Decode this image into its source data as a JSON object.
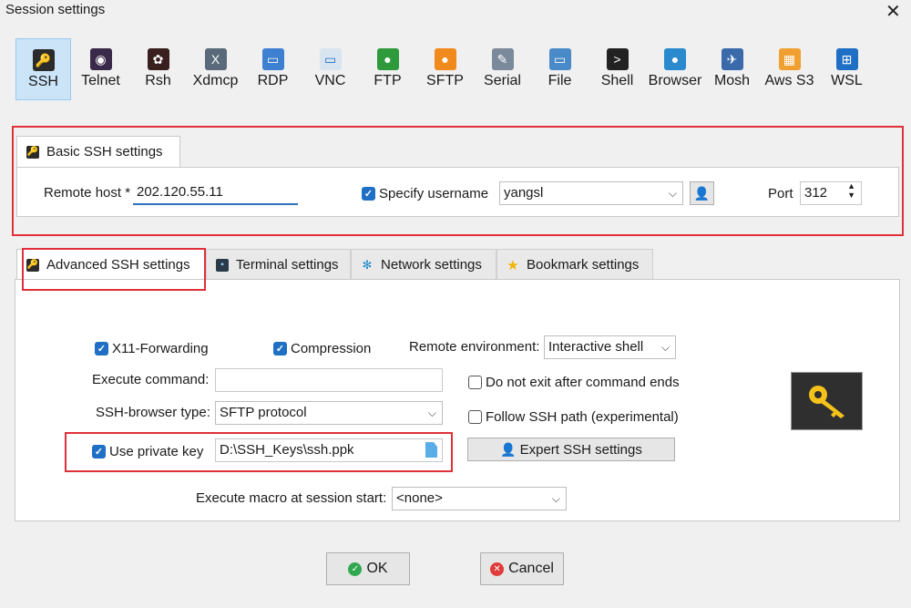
{
  "window": {
    "title": "Session settings"
  },
  "session_types": [
    {
      "label": "SSH",
      "icon": "ssh-key-icon",
      "color": "#2b2b2b"
    },
    {
      "label": "Telnet",
      "icon": "telnet-icon",
      "color": "#3a2a4a"
    },
    {
      "label": "Rsh",
      "icon": "rsh-icon",
      "color": "#3a1f1f"
    },
    {
      "label": "Xdmcp",
      "icon": "xdmcp-icon",
      "color": "#5a6a7a"
    },
    {
      "label": "RDP",
      "icon": "rdp-monitor-icon",
      "color": "#3d7fd1"
    },
    {
      "label": "VNC",
      "icon": "vnc-icon",
      "color": "#d8e4f0"
    },
    {
      "label": "FTP",
      "icon": "ftp-globe-icon",
      "color": "#2e9a3c"
    },
    {
      "label": "SFTP",
      "icon": "sftp-icon",
      "color": "#f08a1c"
    },
    {
      "label": "Serial",
      "icon": "serial-plug-icon",
      "color": "#7a8a9a"
    },
    {
      "label": "File",
      "icon": "file-monitor-icon",
      "color": "#4a8ac8"
    },
    {
      "label": "Shell",
      "icon": "shell-terminal-icon",
      "color": "#222222"
    },
    {
      "label": "Browser",
      "icon": "browser-globe-icon",
      "color": "#2a8acd"
    },
    {
      "label": "Mosh",
      "icon": "mosh-satellite-icon",
      "color": "#3a6aaa"
    },
    {
      "label": "Aws S3",
      "icon": "aws-s3-icon",
      "color": "#f0a030"
    },
    {
      "label": "WSL",
      "icon": "wsl-windows-icon",
      "color": "#1f6fc4"
    }
  ],
  "basic": {
    "tab_label": "Basic SSH settings",
    "remote_host_label": "Remote host *",
    "remote_host_value": "202.120.55.11",
    "specify_username_label": "Specify username",
    "specify_username_checked": true,
    "username_value": "yangsl",
    "port_label": "Port",
    "port_value": "312"
  },
  "tabs": [
    {
      "label": "Advanced SSH settings",
      "icon": "key-icon"
    },
    {
      "label": "Terminal settings",
      "icon": "terminal-icon"
    },
    {
      "label": "Network settings",
      "icon": "network-icon"
    },
    {
      "label": "Bookmark settings",
      "icon": "star-icon"
    }
  ],
  "advanced": {
    "x11_label": "X11-Forwarding",
    "x11_checked": true,
    "compression_label": "Compression",
    "compression_checked": true,
    "remote_env_label": "Remote environment:",
    "remote_env_value": "Interactive shell",
    "exec_cmd_label": "Execute command:",
    "exec_cmd_value": "",
    "no_exit_label": "Do not exit after command ends",
    "no_exit_checked": false,
    "browser_type_label": "SSH-browser type:",
    "browser_type_value": "SFTP protocol",
    "follow_path_label": "Follow SSH path (experimental)",
    "follow_path_checked": false,
    "private_key_label": "Use private key",
    "private_key_checked": true,
    "private_key_value": "D:\\SSH_Keys\\ssh.ppk",
    "expert_button": "Expert SSH settings",
    "macro_label": "Execute macro at session start:",
    "macro_value": "<none>"
  },
  "buttons": {
    "ok": "OK",
    "cancel": "Cancel"
  },
  "colors": {
    "highlight_red": "#e0303a",
    "accent_blue": "#1f6fc4",
    "selected_tab_bg": "#cce4f7"
  }
}
